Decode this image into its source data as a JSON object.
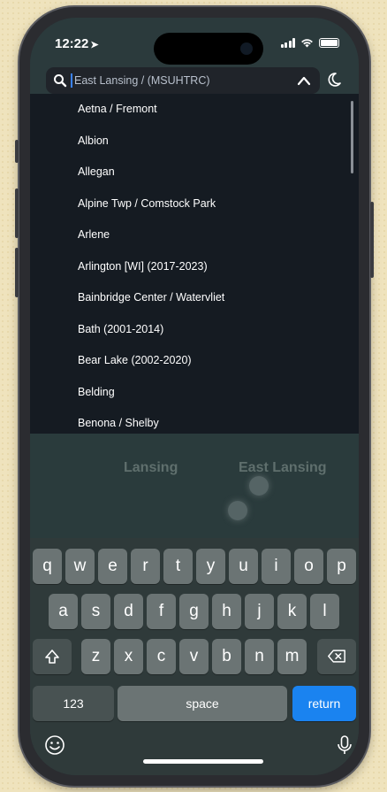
{
  "status": {
    "time": "12:22"
  },
  "search": {
    "value": "East Lansing / (MSUHTRC)"
  },
  "list": {
    "items": [
      "Aetna / Fremont",
      "Albion",
      "Allegan",
      "Alpine Twp / Comstock Park",
      "Arlene",
      "Arlington [WI] (2017-2023)",
      "Bainbridge Center / Watervliet",
      "Bath (2001-2014)",
      "Bear Lake (2002-2020)",
      "Belding",
      "Benona / Shelby"
    ]
  },
  "map": {
    "labels": [
      "Lansing",
      "East Lansing"
    ]
  },
  "keyboard": {
    "row1": [
      "q",
      "w",
      "e",
      "r",
      "t",
      "y",
      "u",
      "i",
      "o",
      "p"
    ],
    "row2": [
      "a",
      "s",
      "d",
      "f",
      "g",
      "h",
      "j",
      "k",
      "l"
    ],
    "row3": [
      "z",
      "x",
      "c",
      "v",
      "b",
      "n",
      "m"
    ],
    "numbers_label": "123",
    "space_label": "space",
    "return_label": "return"
  },
  "colors": {
    "accent": "#1a83f0",
    "list_bg": "#151b22",
    "keyboard_bg": "#2f3a3a",
    "key_bg": "#6b7474"
  },
  "icons": [
    "search-icon",
    "chevron-up-icon",
    "moon-icon",
    "shift-icon",
    "delete-icon",
    "emoji-icon",
    "microphone-icon",
    "location-arrow-icon",
    "signal-icon",
    "wifi-icon",
    "battery-icon"
  ]
}
